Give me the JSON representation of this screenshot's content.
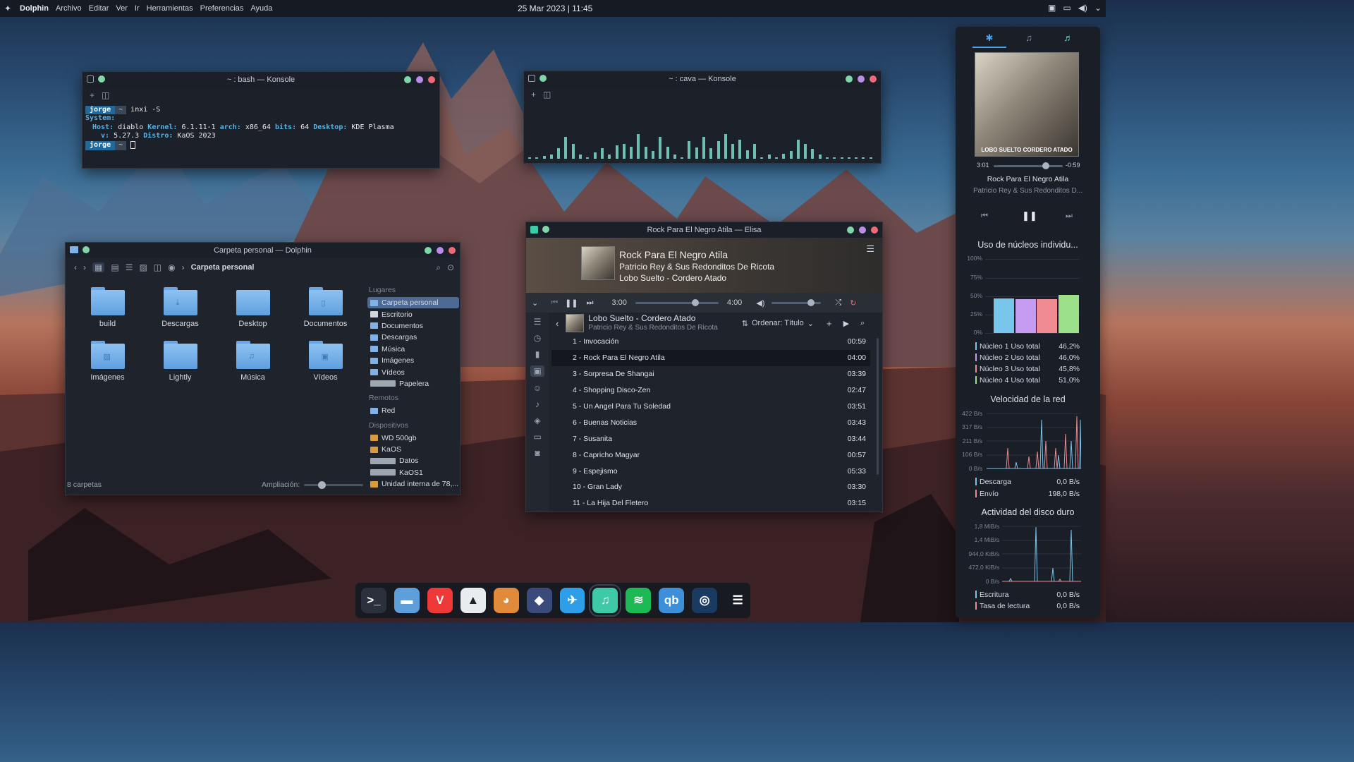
{
  "topbar": {
    "app": "Dolphin",
    "menus": [
      "Archivo",
      "Editar",
      "Ver",
      "Ir",
      "Herramientas",
      "Preferencias",
      "Ayuda"
    ],
    "clock": "25 Mar 2023 | 11:45"
  },
  "konsole_bash": {
    "title": "~ : bash — Konsole",
    "user": "jorge",
    "home": "~",
    "command": "inxi -S",
    "l1": "System:",
    "host_k": "Host:",
    "host_v": "diablo",
    "kernel_k": "Kernel:",
    "kernel_v": "6.1.11-1",
    "arch_k": "arch:",
    "arch_v": "x86_64",
    "bits_k": "bits:",
    "bits_v": "64",
    "desktop_k": "Desktop:",
    "desktop_v": "KDE Plasma",
    "v_k": "v:",
    "v_v": "5.27.3",
    "distro_k": "Distro:",
    "distro_v": "KaOS 2023"
  },
  "konsole_cava": {
    "title": "~ : cava — Konsole",
    "levels": [
      0.02,
      0.05,
      0.08,
      0.12,
      0.3,
      0.62,
      0.42,
      0.12,
      0.05,
      0.18,
      0.3,
      0.12,
      0.38,
      0.42,
      0.35,
      0.7,
      0.35,
      0.22,
      0.62,
      0.35,
      0.12,
      0.05,
      0.5,
      0.32,
      0.62,
      0.3,
      0.5,
      0.7,
      0.42,
      0.55,
      0.25,
      0.42,
      0.05,
      0.12,
      0.02,
      0.15,
      0.22,
      0.55,
      0.42,
      0.28,
      0.12,
      0.05,
      0.02,
      0.02,
      0.02,
      0.05,
      0.02,
      0.02
    ]
  },
  "dolphin": {
    "title": "Carpeta personal — Dolphin",
    "breadcrumb": "Carpeta personal",
    "folders": [
      "build",
      "Descargas",
      "Desktop",
      "Documentos",
      "Imágenes",
      "Lightly",
      "Música",
      "Vídeos"
    ],
    "places_header": "Lugares",
    "places": [
      "Carpeta personal",
      "Escritorio",
      "Documentos",
      "Descargas",
      "Música",
      "Imágenes",
      "Vídeos",
      "Papelera"
    ],
    "remote_header": "Remotos",
    "remote": [
      "Red"
    ],
    "devices_header": "Dispositivos",
    "devices": [
      "WD 500gb",
      "KaOS",
      "Datos",
      "KaOS1",
      "Unidad interna de 78,..."
    ],
    "status": "8 carpetas",
    "zoom_label": "Ampliación:",
    "zoom_level": 0.3
  },
  "elisa": {
    "title": "Rock Para El Negro Atila — Elisa",
    "track": "Rock Para El Negro Atila",
    "artist": "Patricio Rey & Sus Redonditos De Ricota",
    "album_line": "Lobo Suelto - Cordero Atado",
    "elapsed": "3:00",
    "total": "4:00",
    "progress": 0.72,
    "volume": 0.8,
    "album_name": "Lobo Suelto - Cordero Atado",
    "album_artist": "Patricio Rey & Sus Redonditos De Ricota",
    "sort_label": "Ordenar: Título",
    "tracks": [
      {
        "name": "1 - Invocación",
        "dur": "00:59"
      },
      {
        "name": "2 - Rock Para El Negro Atila",
        "dur": "04:00"
      },
      {
        "name": "3 - Sorpresa De Shangai",
        "dur": "03:39"
      },
      {
        "name": "4 - Shopping Disco-Zen",
        "dur": "02:47"
      },
      {
        "name": "5 - Un Angel Para Tu Soledad",
        "dur": "03:51"
      },
      {
        "name": "6 - Buenas Noticias",
        "dur": "03:43"
      },
      {
        "name": "7 - Susanita",
        "dur": "03:44"
      },
      {
        "name": "8 - Capricho Magyar",
        "dur": "00:57"
      },
      {
        "name": "9 - Espejismo",
        "dur": "05:33"
      },
      {
        "name": "10 - Gran Lady",
        "dur": "03:30"
      },
      {
        "name": "11 - La Hija Del Fletero",
        "dur": "03:15"
      }
    ]
  },
  "panel": {
    "player": {
      "elapsed": "3:01",
      "remaining": "-0:59",
      "progress": 0.75,
      "title": "Rock Para El Negro Atila",
      "artist": "Patricio Rey & Sus Redonditos D...",
      "cover_text": "LOBO SUELTO CORDERO ATADO"
    },
    "cpu": {
      "title": "Uso de núcleos individu...",
      "ylabels": [
        "100%",
        "75%",
        "50%",
        "25%",
        "0%"
      ],
      "cores": [
        {
          "label": "Núcleo 1 Uso total",
          "value": "46,2%",
          "pct": 46.2,
          "color": "#79c6ec"
        },
        {
          "label": "Núcleo 2 Uso total",
          "value": "46,0%",
          "pct": 46.0,
          "color": "#c59cf1"
        },
        {
          "label": "Núcleo 3 Uso total",
          "value": "45,8%",
          "pct": 45.8,
          "color": "#f08a93"
        },
        {
          "label": "Núcleo 4 Uso total",
          "value": "51,0%",
          "pct": 51.0,
          "color": "#9de08a"
        }
      ]
    },
    "net": {
      "title": "Velocidad de la red",
      "ylabels": [
        "422 B/s",
        "317 B/s",
        "211 B/s",
        "106 B/s",
        "0 B/s"
      ],
      "download_label": "Descarga",
      "download_value": "0,0 B/s",
      "upload_label": "Envío",
      "upload_value": "198,0 B/s",
      "colors": {
        "down": "#79c6ec",
        "up": "#f08a93"
      }
    },
    "disk": {
      "title": "Actividad del disco duro",
      "ylabels": [
        "1,8 MiB/s",
        "1,4 MiB/s",
        "944,0 KiB/s",
        "472,0 KiB/s",
        "0 B/s"
      ],
      "write_label": "Escritura",
      "write_value": "0,0 B/s",
      "read_label": "Tasa de lectura",
      "read_value": "0,0 B/s"
    }
  },
  "dock": [
    {
      "name": "konsole",
      "glyph": ">_",
      "color": "#2b313c"
    },
    {
      "name": "dolphin",
      "glyph": "▬",
      "color": "#5e9edb"
    },
    {
      "name": "vivaldi",
      "glyph": "V",
      "color": "#ef3939"
    },
    {
      "name": "inkscape",
      "glyph": "▲",
      "color": "#e9ecef"
    },
    {
      "name": "gimp",
      "glyph": "◕",
      "color": "#e08a3a"
    },
    {
      "name": "vpn",
      "glyph": "◆",
      "color": "#3a4a7a"
    },
    {
      "name": "kite",
      "glyph": "✈",
      "color": "#2f9ee8"
    },
    {
      "name": "elisa",
      "glyph": "♫",
      "color": "#3ec9a7"
    },
    {
      "name": "spotify",
      "glyph": "≋",
      "color": "#1db954"
    },
    {
      "name": "qbittorrent",
      "glyph": "qb",
      "color": "#3d8fd8"
    },
    {
      "name": "steam",
      "glyph": "◎",
      "color": "#1b3a62"
    },
    {
      "name": "menu",
      "glyph": "☰",
      "color": "transparent"
    }
  ]
}
